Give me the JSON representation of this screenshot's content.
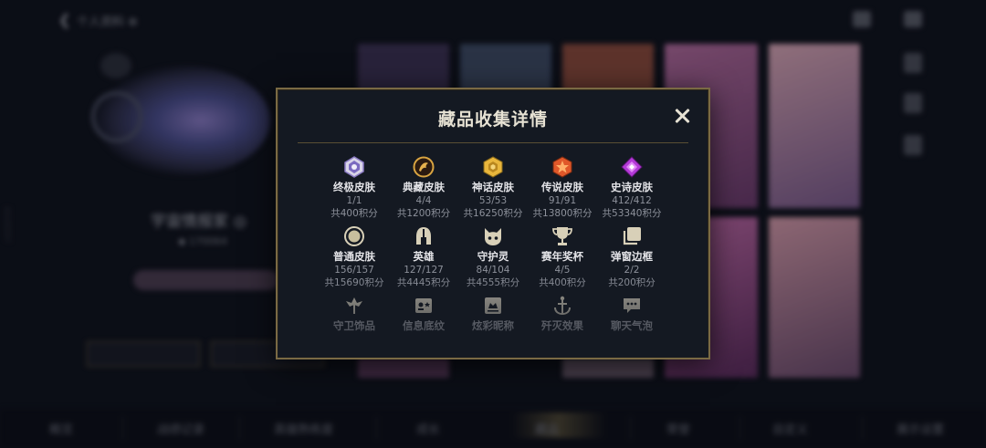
{
  "background": {
    "header_title": "个人资料 ⊕",
    "profile_name": "宇宙情报家 ◎",
    "profile_sub": "◆ 170064",
    "left_edge_text": "4026097",
    "bottom_tabs": [
      "概览",
      "战绩记录",
      "英雄熟练度",
      "成长",
      "藏品",
      "荣誉",
      "自定义",
      "展示设置"
    ]
  },
  "modal": {
    "title": "藏品收集详情",
    "close_icon": "close-icon",
    "accent_color": "#7a6a44",
    "rows": [
      [
        {
          "icon": "ultimate-skin-icon",
          "label": "终极皮肤",
          "count": "1/1",
          "points": "共400积分"
        },
        {
          "icon": "prestige-skin-icon",
          "label": "典藏皮肤",
          "count": "4/4",
          "points": "共1200积分"
        },
        {
          "icon": "mythic-skin-icon",
          "label": "神话皮肤",
          "count": "53/53",
          "points": "共16250积分"
        },
        {
          "icon": "legendary-skin-icon",
          "label": "传说皮肤",
          "count": "91/91",
          "points": "共13800积分"
        },
        {
          "icon": "epic-skin-icon",
          "label": "史诗皮肤",
          "count": "412/412",
          "points": "共53340积分"
        }
      ],
      [
        {
          "icon": "standard-skin-icon",
          "label": "普通皮肤",
          "count": "156/157",
          "points": "共15690积分"
        },
        {
          "icon": "champion-helmet-icon",
          "label": "英雄",
          "count": "127/127",
          "points": "共4445积分"
        },
        {
          "icon": "guardian-icon",
          "label": "守护灵",
          "count": "84/104",
          "points": "共4555积分"
        },
        {
          "icon": "trophy-icon",
          "label": "赛年奖杯",
          "count": "4/5",
          "points": "共400积分"
        },
        {
          "icon": "frame-icon",
          "label": "弹窗边框",
          "count": "2/2",
          "points": "共200积分"
        }
      ],
      [
        {
          "icon": "ward-skin-icon",
          "label": "守卫饰品"
        },
        {
          "icon": "profile-banner-icon",
          "label": "信息底纹"
        },
        {
          "icon": "title-icon",
          "label": "炫彩昵称"
        },
        {
          "icon": "finisher-icon",
          "label": "歼灭效果"
        },
        {
          "icon": "chat-bubble-icon",
          "label": "聊天气泡"
        }
      ]
    ]
  }
}
